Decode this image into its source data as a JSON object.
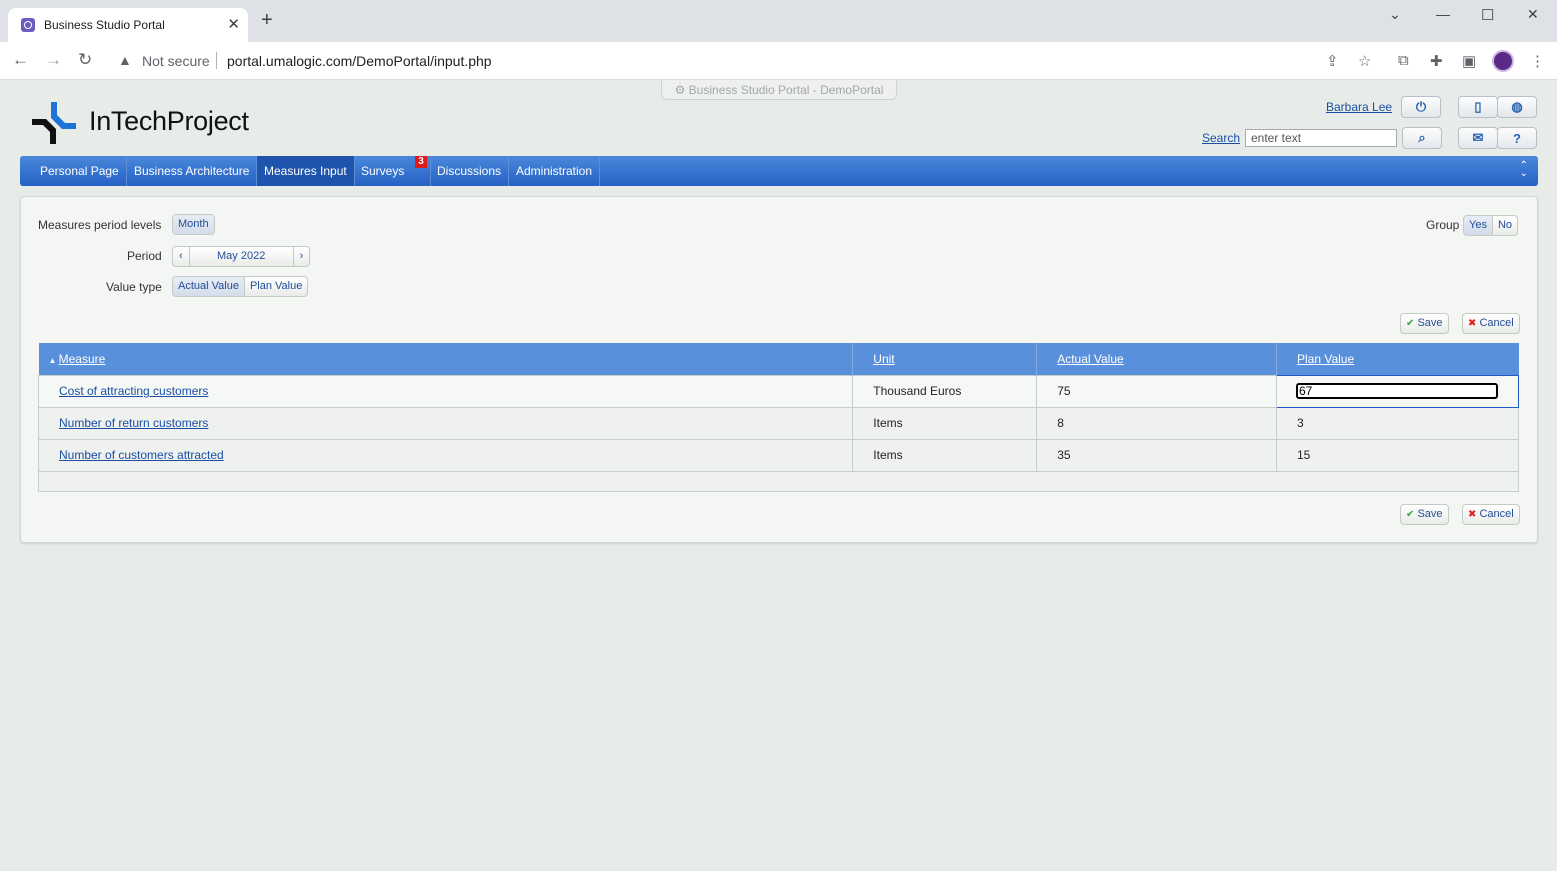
{
  "browser": {
    "tab_title": "Business Studio Portal",
    "security_label": "Not secure",
    "url": "portal.umalogic.com/DemoPortal/input.php"
  },
  "portal": {
    "window_label": "Business Studio Portal - DemoPortal",
    "logo_text": "InTechProject",
    "user_name": "Barbara Lee",
    "search_label": "Search",
    "search_placeholder": "enter text"
  },
  "nav": {
    "items": [
      {
        "label": "Personal Page"
      },
      {
        "label": "Business Architecture"
      },
      {
        "label": "Measures Input"
      },
      {
        "label": "Surveys",
        "badge": "3"
      },
      {
        "label": "Discussions"
      },
      {
        "label": "Administration"
      }
    ],
    "active": "Measures Input"
  },
  "filters": {
    "period_levels_label": "Measures period levels",
    "period_level_value": "Month",
    "period_label": "Period",
    "period_value": "May 2022",
    "value_type_label": "Value type",
    "value_types": [
      "Actual Value",
      "Plan Value"
    ],
    "group_label": "Group",
    "group_options": [
      "Yes",
      "No"
    ]
  },
  "actions": {
    "save": "Save",
    "cancel": "Cancel"
  },
  "table": {
    "columns": [
      "Measure",
      "Unit",
      "Actual Value",
      "Plan Value"
    ],
    "rows": [
      {
        "measure": "Cost of attracting customers",
        "unit": "Thousand Euros",
        "actual": "75",
        "plan": "67"
      },
      {
        "measure": "Number of return customers",
        "unit": "Items",
        "actual": "8",
        "plan": "3"
      },
      {
        "measure": "Number of customers attracted",
        "unit": "Items",
        "actual": "35",
        "plan": "15"
      }
    ]
  },
  "colors": {
    "nav_gradient_top": "#4a88dc",
    "nav_gradient_bottom": "#2561c4",
    "table_header": "#5990dc",
    "link": "#1a4fa3",
    "badge": "#e01919"
  }
}
